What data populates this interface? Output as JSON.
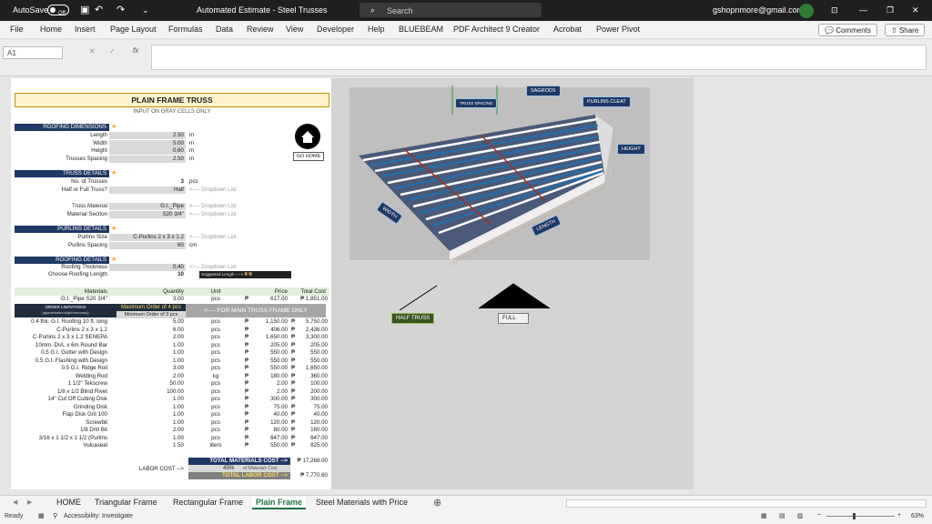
{
  "titlebar": {
    "autosave": "AutoSave",
    "toggle": "Off",
    "title": "Automated Estimate - Steel Trusses",
    "search_placeholder": "Search",
    "email": "gshopnmore@gmail.com"
  },
  "menu": [
    "File",
    "Home",
    "Insert",
    "Page Layout",
    "Formulas",
    "Data",
    "Review",
    "View",
    "Developer",
    "Help",
    "BLUEBEAM",
    "PDF Architect 9 Creator",
    "Acrobat",
    "Power Pivot"
  ],
  "menu_buttons": {
    "comments": "Comments",
    "share": "Share"
  },
  "formula": {
    "namebox": "A1",
    "fx": "fx"
  },
  "sheet": {
    "title": "PLAIN FRAME TRUSS",
    "subtitle": "INPUT ON GRAY CELLS ONLY",
    "roofing": {
      "header": "ROOFING DIMENSIONS",
      "rows": [
        {
          "label": "Length",
          "value": "2.50",
          "unit": "m"
        },
        {
          "label": "Width",
          "value": "5.00",
          "unit": "m"
        },
        {
          "label": "Height",
          "value": "0.60",
          "unit": "m"
        },
        {
          "label": "Trusses Spacing",
          "value": "2.50",
          "unit": "m"
        }
      ]
    },
    "go_home": "GO HOME",
    "truss": {
      "header": "TRUSS DETAILS",
      "rows": [
        {
          "label": "No. of Trusses",
          "value": "3",
          "unit": "pcs",
          "note": ""
        },
        {
          "label": "Half or Full Truss?",
          "value": "Half",
          "unit": "",
          "note": "<---- Dropdown List"
        },
        {
          "label": "Truss Material",
          "value": "G.I._Pipe",
          "unit": "",
          "note": "<---- Dropdown List"
        },
        {
          "label": "Material Section",
          "value": "S20 3/4\"",
          "unit": "",
          "note": "<---- Dropdown List"
        }
      ]
    },
    "purlins": {
      "header": "PURLINS DETAILS",
      "rows": [
        {
          "label": "Purlins Size",
          "value": "C-Purlins 2 x 3 x 1.2",
          "unit": "",
          "note": "<---- Dropdown List"
        },
        {
          "label": "Purlins Spacing",
          "value": "60",
          "unit": "cm",
          "note": ""
        }
      ]
    },
    "roofing2": {
      "header": "ROOFING DETAILS",
      "rows": [
        {
          "label": "Roofing Thickness",
          "value": "0.40",
          "note": "<---- Dropdown List"
        },
        {
          "label": "Choose Roofing Length",
          "value": "10",
          "note": "Suggested Length ---->",
          "note2": "9 ft"
        }
      ]
    },
    "table": {
      "headers": [
        "Materials",
        "Quantity",
        "Unit",
        "Price",
        "Total Cost"
      ],
      "first": {
        "name": "G.I._Pipe S20 3/4\"",
        "qty": "3.00",
        "unit": "pcs",
        "cur": "₱",
        "price": "617.00",
        "total": "₱ 1,851.00"
      },
      "order_limitations": "ORDER LIMITATIONS",
      "order_note": "(approximation slight inaccuracy)",
      "max_order": "Maximum Order of 4 pcs",
      "min_order": "Minimum Order of 3 pcs",
      "main_frame": "<---- FOR MAIN TRUSS FRAME ONLY",
      "rows": [
        {
          "name": "0.4 thk. G.I. Roofing 10 ft. long",
          "qty": "5.00",
          "unit": "pcs",
          "price": "1,150.00",
          "total": "5,750.00"
        },
        {
          "name": "C-Purlins 2 x 3 x 1.2",
          "qty": "6.00",
          "unit": "pcs",
          "price": "406.00",
          "total": "2,436.00"
        },
        {
          "name": "C-Purlins 2 x 3 x 1.2  SENEPA",
          "qty": "2.00",
          "unit": "pcs",
          "price": "1,650.00",
          "total": "3,300.00"
        },
        {
          "name": "10mm. DIA. x 6m Round Bar",
          "qty": "1.00",
          "unit": "pcs",
          "price": "205.00",
          "total": "205.00"
        },
        {
          "name": "0.5 G.I. Gutter with Design",
          "qty": "1.00",
          "unit": "pcs",
          "price": "550.00",
          "total": "550.00"
        },
        {
          "name": "0.5 G.I. Flashing with Design",
          "qty": "1.00",
          "unit": "pcs",
          "price": "550.00",
          "total": "550.00"
        },
        {
          "name": "0.5 G.I. Ridge Roll",
          "qty": "3.00",
          "unit": "pcs",
          "price": "550.00",
          "total": "1,650.00"
        },
        {
          "name": "Welding Rod",
          "qty": "2.00",
          "unit": "kg",
          "price": "180.00",
          "total": "360.00"
        },
        {
          "name": "1 1/2\" Tekscrew",
          "qty": "50.00",
          "unit": "pcs",
          "price": "2.00",
          "total": "100.00"
        },
        {
          "name": "1/8 x 1/2 Blind Rivet",
          "qty": "100.00",
          "unit": "pcs",
          "price": "2.00",
          "total": "200.00"
        },
        {
          "name": "14\" Cut Off Cutting Disk",
          "qty": "1.00",
          "unit": "pcs",
          "price": "300.00",
          "total": "300.00"
        },
        {
          "name": "Grinding Disk",
          "qty": "1.00",
          "unit": "pcs",
          "price": "75.00",
          "total": "75.00"
        },
        {
          "name": "Flap Disk Grit 100",
          "qty": "1.00",
          "unit": "pcs",
          "price": "40.00",
          "total": "40.00"
        },
        {
          "name": "Screwbit",
          "qty": "1.00",
          "unit": "pcs",
          "price": "120.00",
          "total": "120.00"
        },
        {
          "name": "1/8 Drill Bit",
          "qty": "2.00",
          "unit": "pcs",
          "price": "80.00",
          "total": "160.00"
        },
        {
          "name": "3/16 x 1 1/2 x 1 1/2 (Purlins",
          "qty": "1.00",
          "unit": "pcs",
          "price": "647.00",
          "total": "647.00"
        },
        {
          "name": "Vulcaseal",
          "qty": "1.50",
          "unit": "liters",
          "price": "550.00",
          "total": "825.00"
        }
      ]
    },
    "totals": {
      "materials_label": "TOTAL MATERIALS COST -->",
      "materials_value": "₱ 17,268.00",
      "labor_label": "LABOR COST -->",
      "labor_pct": "45%",
      "labor_of": "of Materials Cost",
      "labor_total_label": "TOTAL LABOR COST -->",
      "labor_total_value": "₱ 7,770.60"
    }
  },
  "diagram": {
    "labels": [
      "TRUSS SPACING",
      "SAGRODS",
      "PURLINS CLEAT",
      "HEIGHT",
      "WIDTH",
      "LENGTH"
    ],
    "half_truss": "HALF TRUSS",
    "full": "FULL"
  },
  "tabs": [
    "HOME",
    "Triangular Frame",
    "Rectangular Frame",
    "Plain Frame",
    "Steel Materials with Price"
  ],
  "status": {
    "ready": "Ready",
    "accessibility": "Accessibility: Investigate",
    "zoom": "63%"
  }
}
